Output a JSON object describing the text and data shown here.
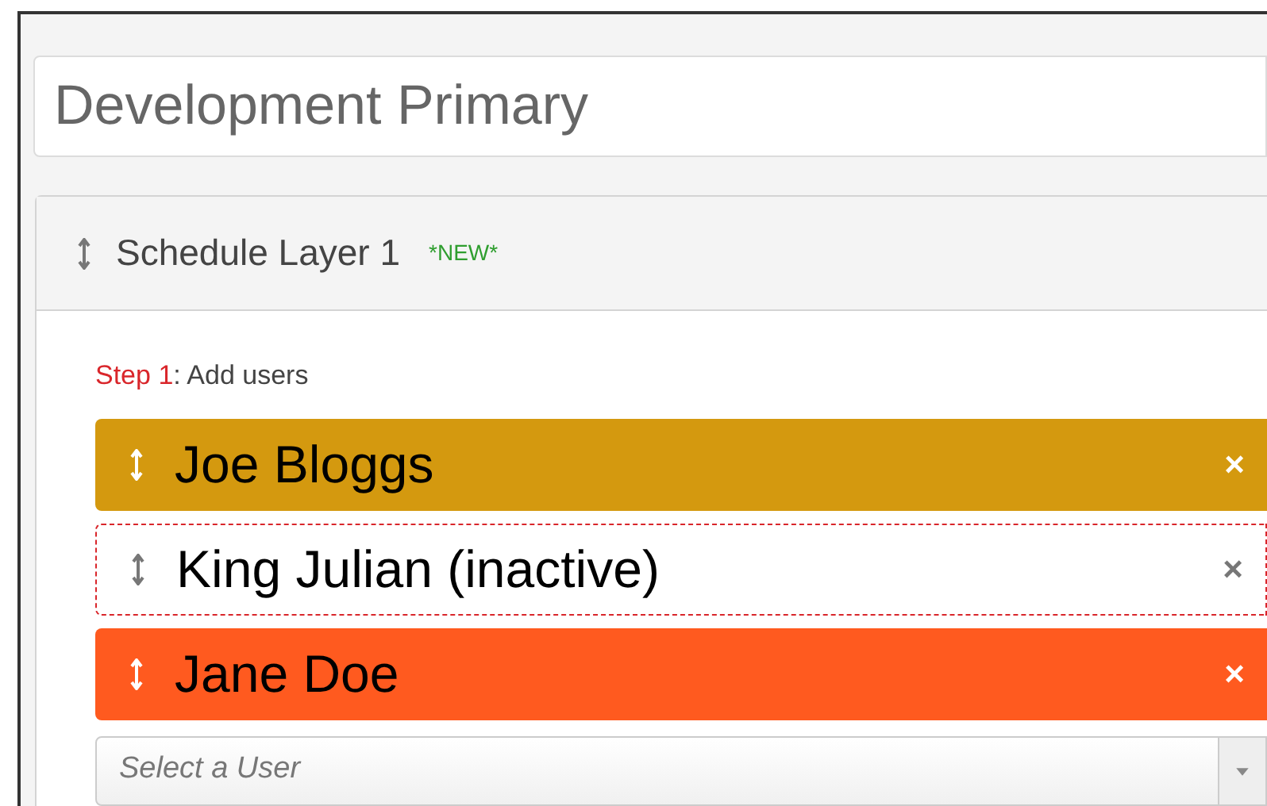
{
  "schedule_name": {
    "value": "Development Primary"
  },
  "layer": {
    "title": "Schedule Layer 1",
    "badge": "*NEW*",
    "step": {
      "label": "Step 1",
      "text": ": Add users"
    },
    "users": [
      {
        "name": "Joe Bloggs",
        "color": "#d4990f",
        "inactive": false,
        "remove": "×"
      },
      {
        "name": "King Julian (inactive)",
        "color": "#ffffff",
        "inactive": true,
        "remove": "×"
      },
      {
        "name": "Jane Doe",
        "color": "#ff5a1f",
        "inactive": false,
        "remove": "×"
      }
    ],
    "select": {
      "placeholder": "Select a User"
    }
  }
}
